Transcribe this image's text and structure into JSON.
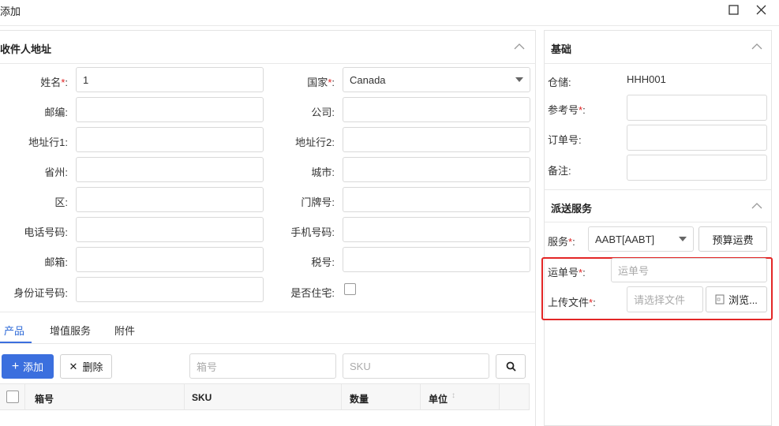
{
  "dialog": {
    "title": "添加"
  },
  "recipient": {
    "title": "收件人地址",
    "left_fields": [
      {
        "label": "姓名",
        "required": "*",
        "colon": ":",
        "value": "1",
        "placeholder": ""
      },
      {
        "label": "邮编",
        "required": "",
        "colon": ":",
        "value": "",
        "placeholder": ""
      },
      {
        "label": "地址行1",
        "required": "",
        "colon": ":",
        "value": "",
        "placeholder": ""
      },
      {
        "label": "省州",
        "required": "",
        "colon": ":",
        "value": "",
        "placeholder": ""
      },
      {
        "label": "区",
        "required": "",
        "colon": ":",
        "value": "",
        "placeholder": ""
      },
      {
        "label": "电话号码",
        "required": "",
        "colon": ":",
        "value": "",
        "placeholder": ""
      },
      {
        "label": "邮箱",
        "required": "",
        "colon": ":",
        "value": "",
        "placeholder": ""
      },
      {
        "label": "身份证号码",
        "required": "",
        "colon": ":",
        "value": "",
        "placeholder": ""
      }
    ],
    "right_fields": [
      {
        "label": "国家",
        "required": "*",
        "colon": ":",
        "value": "Canada"
      },
      {
        "label": "公司",
        "required": "",
        "colon": ":",
        "value": ""
      },
      {
        "label": "地址行2",
        "required": "",
        "colon": ":",
        "value": ""
      },
      {
        "label": "城市",
        "required": "",
        "colon": ":",
        "value": ""
      },
      {
        "label": "门牌号",
        "required": "",
        "colon": ":",
        "value": ""
      },
      {
        "label": "手机号码",
        "required": "",
        "colon": ":",
        "value": ""
      },
      {
        "label": "税号",
        "required": "",
        "colon": ":",
        "value": ""
      },
      {
        "label": "是否住宅",
        "required": "",
        "colon": ":",
        "checked": false
      }
    ]
  },
  "tabs": [
    {
      "label": "产品",
      "active": true
    },
    {
      "label": "增值服务",
      "active": false
    },
    {
      "label": "附件",
      "active": false
    }
  ],
  "products": {
    "add_label": "添加",
    "delete_label": "删除",
    "box_placeholder": "箱号",
    "sku_placeholder": "SKU",
    "columns": [
      "箱号",
      "SKU",
      "数量",
      "单位"
    ]
  },
  "basic": {
    "title": "基础",
    "warehouse_label": "仓储",
    "warehouse_value": "HHH001",
    "ref_label": "参考号",
    "ref_required": "*",
    "order_label": "订单号",
    "remark_label": "备注",
    "colon": ":"
  },
  "delivery": {
    "title": "派送服务",
    "service_label": "服务",
    "service_required": "*",
    "service_value": "AABT[AABT]",
    "estimate_label": "预算运费",
    "tracking_label": "运单号",
    "tracking_required": "*",
    "tracking_placeholder": "运单号",
    "upload_label": "上传文件",
    "upload_required": "*",
    "upload_placeholder": "请选择文件",
    "browse_label": "浏览..."
  },
  "colors": {
    "accent": "#3b6fde",
    "required": "#e02020",
    "highlight_border": "#e32626"
  },
  "icons": {
    "maximize": "maximize-icon",
    "close": "close-icon",
    "collapse": "chevron-up-icon",
    "search": "search-icon",
    "plus": "plus-icon",
    "delete": "x-icon",
    "file": "file-icon",
    "sort": "sort-icon"
  }
}
